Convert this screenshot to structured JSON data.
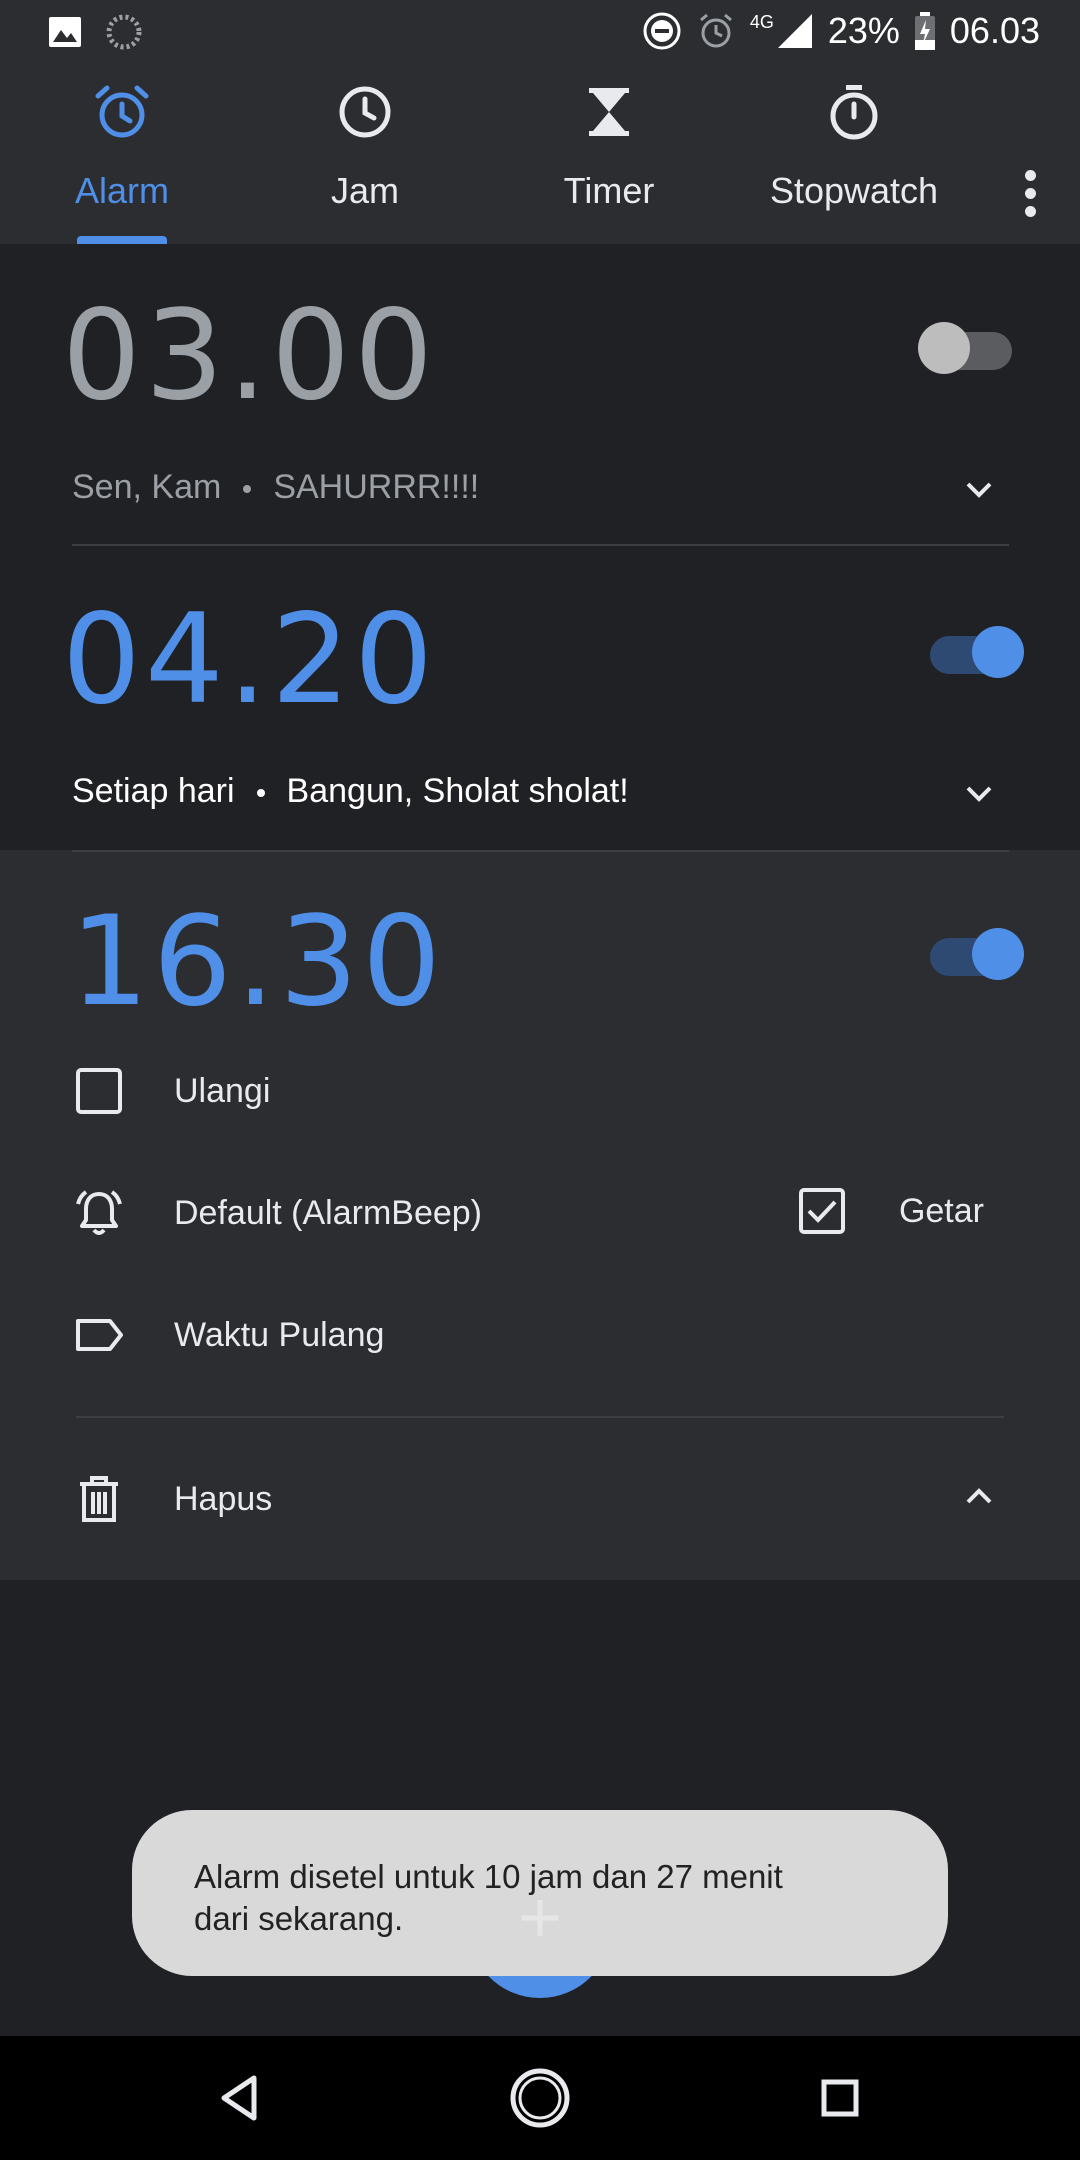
{
  "status_bar": {
    "battery": "23%",
    "time": "06.03",
    "network": "4G",
    "icons": [
      "gallery-icon",
      "sync-icon",
      "dnd-icon",
      "alarm-icon",
      "signal-icon",
      "battery-charging-icon"
    ]
  },
  "tabs": [
    {
      "label": "Alarm",
      "icon": "alarm-clock-icon",
      "active": true
    },
    {
      "label": "Jam",
      "icon": "clock-icon",
      "active": false
    },
    {
      "label": "Timer",
      "icon": "hourglass-icon",
      "active": false
    },
    {
      "label": "Stopwatch",
      "icon": "stopwatch-icon",
      "active": false
    }
  ],
  "alarms": [
    {
      "time": "03.00",
      "enabled": false,
      "days": "Sen, Kam",
      "label": "SAHURRR!!!!",
      "expanded": false
    },
    {
      "time": "04.20",
      "enabled": true,
      "days": "Setiap hari",
      "label": "Bangun, Sholat sholat!",
      "expanded": false
    },
    {
      "time": "16.30",
      "enabled": true,
      "expanded": true,
      "repeat_label": "Ulangi",
      "repeat_checked": false,
      "ringtone": "Default (AlarmBeep)",
      "vibrate_label": "Getar",
      "vibrate_checked": true,
      "label": "Waktu Pulang",
      "delete_label": "Hapus"
    }
  ],
  "toast": {
    "line1": "Alarm disetel untuk 10 jam dan 27 menit",
    "line2": "dari sekarang."
  },
  "colors": {
    "accent": "#4f8fe8",
    "background": "#202124",
    "surface": "#2b2d31",
    "toast": "#d9d9d9"
  }
}
